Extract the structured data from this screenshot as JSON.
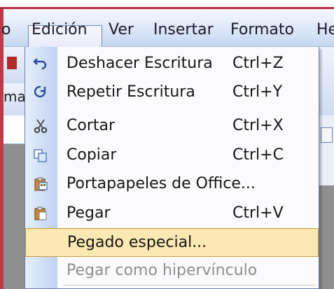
{
  "menubar": {
    "items": [
      {
        "label": "o"
      },
      {
        "label": "Edición"
      },
      {
        "label": "Ver"
      },
      {
        "label": "Insertar"
      },
      {
        "label": "Formato"
      },
      {
        "label": "He"
      }
    ]
  },
  "background": {
    "left_fragment_text": "ma"
  },
  "edit_menu": {
    "items": [
      {
        "icon": "undo-icon",
        "label": "Deshacer Escritura",
        "shortcut": "Ctrl+Z"
      },
      {
        "icon": "redo-icon",
        "label": "Repetir Escritura",
        "shortcut": "Ctrl+Y"
      },
      {
        "icon": "scissors-icon",
        "label": "Cortar",
        "shortcut": "Ctrl+X"
      },
      {
        "icon": "copy-icon",
        "label": "Copiar",
        "shortcut": "Ctrl+C"
      },
      {
        "icon": "office-clipboard-icon",
        "label": "Portapapeles de Office...",
        "shortcut": ""
      },
      {
        "icon": "paste-icon",
        "label": "Pegar",
        "shortcut": "Ctrl+V"
      },
      {
        "icon": "",
        "label": "Pegado especial...",
        "shortcut": "",
        "state": "highlighted"
      },
      {
        "icon": "",
        "label": "Pegar como hipervínculo",
        "shortcut": "",
        "state": "disabled"
      }
    ]
  },
  "colors": {
    "highlight": "#fce8b2",
    "highlight_border": "#c79b3a",
    "gutter": "#bfd2f1",
    "window_frame": "#c23848"
  }
}
